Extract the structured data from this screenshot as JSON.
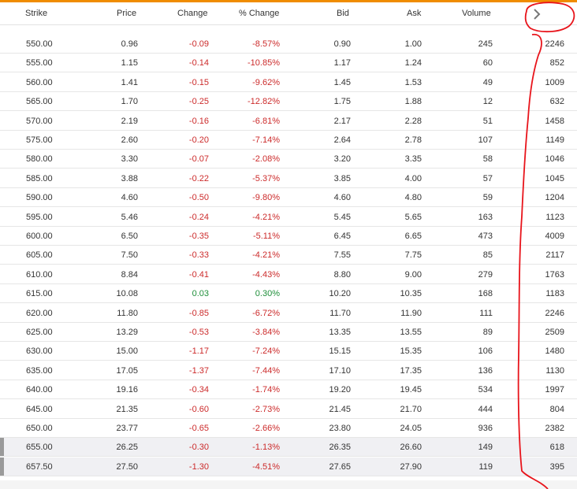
{
  "header": {
    "strike": "Strike",
    "price": "Price",
    "change": "Change",
    "pct_change": "% Change",
    "bid": "Bid",
    "ask": "Ask",
    "volume": "Volume",
    "scroll_icon": "chevron-right-icon"
  },
  "colors": {
    "accent": "#f08c00",
    "negative": "#cc2b2b",
    "positive": "#1f8f3a",
    "annotation": "#e8141b"
  },
  "rows": [
    {
      "strike": "550.00",
      "price": "0.96",
      "change": "-0.09",
      "pct": "-8.57%",
      "bid": "0.90",
      "ask": "1.00",
      "volume": "245",
      "oi": "2246"
    },
    {
      "strike": "555.00",
      "price": "1.15",
      "change": "-0.14",
      "pct": "-10.85%",
      "bid": "1.17",
      "ask": "1.24",
      "volume": "60",
      "oi": "852"
    },
    {
      "strike": "560.00",
      "price": "1.41",
      "change": "-0.15",
      "pct": "-9.62%",
      "bid": "1.45",
      "ask": "1.53",
      "volume": "49",
      "oi": "1009"
    },
    {
      "strike": "565.00",
      "price": "1.70",
      "change": "-0.25",
      "pct": "-12.82%",
      "bid": "1.75",
      "ask": "1.88",
      "volume": "12",
      "oi": "632"
    },
    {
      "strike": "570.00",
      "price": "2.19",
      "change": "-0.16",
      "pct": "-6.81%",
      "bid": "2.17",
      "ask": "2.28",
      "volume": "51",
      "oi": "1458"
    },
    {
      "strike": "575.00",
      "price": "2.60",
      "change": "-0.20",
      "pct": "-7.14%",
      "bid": "2.64",
      "ask": "2.78",
      "volume": "107",
      "oi": "1149"
    },
    {
      "strike": "580.00",
      "price": "3.30",
      "change": "-0.07",
      "pct": "-2.08%",
      "bid": "3.20",
      "ask": "3.35",
      "volume": "58",
      "oi": "1046"
    },
    {
      "strike": "585.00",
      "price": "3.88",
      "change": "-0.22",
      "pct": "-5.37%",
      "bid": "3.85",
      "ask": "4.00",
      "volume": "57",
      "oi": "1045"
    },
    {
      "strike": "590.00",
      "price": "4.60",
      "change": "-0.50",
      "pct": "-9.80%",
      "bid": "4.60",
      "ask": "4.80",
      "volume": "59",
      "oi": "1204"
    },
    {
      "strike": "595.00",
      "price": "5.46",
      "change": "-0.24",
      "pct": "-4.21%",
      "bid": "5.45",
      "ask": "5.65",
      "volume": "163",
      "oi": "1123"
    },
    {
      "strike": "600.00",
      "price": "6.50",
      "change": "-0.35",
      "pct": "-5.11%",
      "bid": "6.45",
      "ask": "6.65",
      "volume": "473",
      "oi": "4009"
    },
    {
      "strike": "605.00",
      "price": "7.50",
      "change": "-0.33",
      "pct": "-4.21%",
      "bid": "7.55",
      "ask": "7.75",
      "volume": "85",
      "oi": "2117"
    },
    {
      "strike": "610.00",
      "price": "8.84",
      "change": "-0.41",
      "pct": "-4.43%",
      "bid": "8.80",
      "ask": "9.00",
      "volume": "279",
      "oi": "1763"
    },
    {
      "strike": "615.00",
      "price": "10.08",
      "change": "0.03",
      "pct": "0.30%",
      "bid": "10.20",
      "ask": "10.35",
      "volume": "168",
      "oi": "1183"
    },
    {
      "strike": "620.00",
      "price": "11.80",
      "change": "-0.85",
      "pct": "-6.72%",
      "bid": "11.70",
      "ask": "11.90",
      "volume": "111",
      "oi": "2246"
    },
    {
      "strike": "625.00",
      "price": "13.29",
      "change": "-0.53",
      "pct": "-3.84%",
      "bid": "13.35",
      "ask": "13.55",
      "volume": "89",
      "oi": "2509"
    },
    {
      "strike": "630.00",
      "price": "15.00",
      "change": "-1.17",
      "pct": "-7.24%",
      "bid": "15.15",
      "ask": "15.35",
      "volume": "106",
      "oi": "1480"
    },
    {
      "strike": "635.00",
      "price": "17.05",
      "change": "-1.37",
      "pct": "-7.44%",
      "bid": "17.10",
      "ask": "17.35",
      "volume": "136",
      "oi": "1130"
    },
    {
      "strike": "640.00",
      "price": "19.16",
      "change": "-0.34",
      "pct": "-1.74%",
      "bid": "19.20",
      "ask": "19.45",
      "volume": "534",
      "oi": "1997"
    },
    {
      "strike": "645.00",
      "price": "21.35",
      "change": "-0.60",
      "pct": "-2.73%",
      "bid": "21.45",
      "ask": "21.70",
      "volume": "444",
      "oi": "804"
    },
    {
      "strike": "650.00",
      "price": "23.77",
      "change": "-0.65",
      "pct": "-2.66%",
      "bid": "23.80",
      "ask": "24.05",
      "volume": "936",
      "oi": "2382"
    },
    {
      "strike": "655.00",
      "price": "26.25",
      "change": "-0.30",
      "pct": "-1.13%",
      "bid": "26.35",
      "ask": "26.60",
      "volume": "149",
      "oi": "618",
      "highlight": true
    },
    {
      "strike": "657.50",
      "price": "27.50",
      "change": "-1.30",
      "pct": "-4.51%",
      "bid": "27.65",
      "ask": "27.90",
      "volume": "119",
      "oi": "395",
      "highlight": true
    }
  ]
}
